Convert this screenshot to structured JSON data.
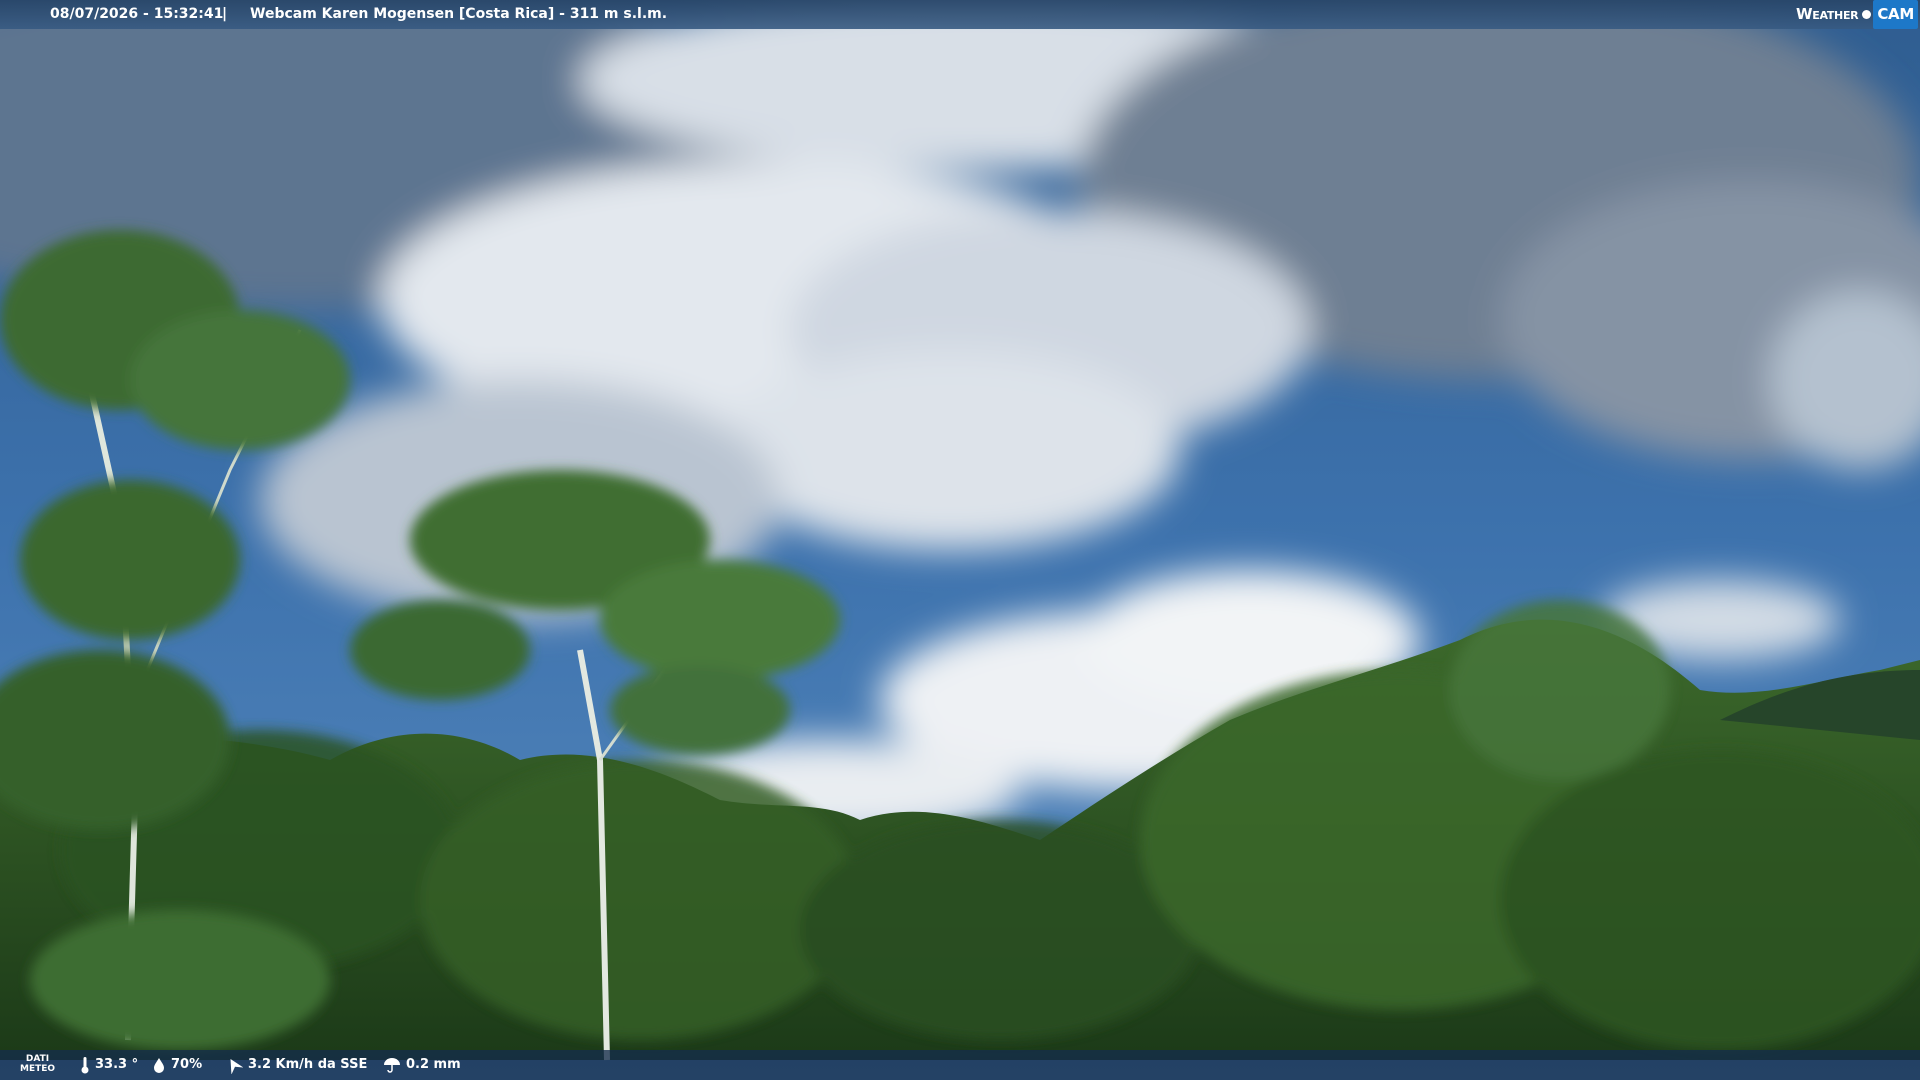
{
  "header": {
    "datetime": "08/07/2026 - 15:32:41",
    "separator": "|",
    "title": "Webcam Karen Mogensen [Costa Rica]  - 311 m s.l.m."
  },
  "logo": {
    "weather": "Weather",
    "cam": "CAM"
  },
  "footer": {
    "label_line1": "DATI",
    "label_line2": "METEO",
    "temperature": "33.3 °",
    "humidity": "70%",
    "wind": "3.2 Km/h da SSE",
    "rain": "0.2 mm"
  },
  "colors": {
    "sky": "#3f72ad",
    "cloud": "#e8edf2",
    "foliage": "#2f5a25",
    "cam_badge": "#1d78c8"
  }
}
